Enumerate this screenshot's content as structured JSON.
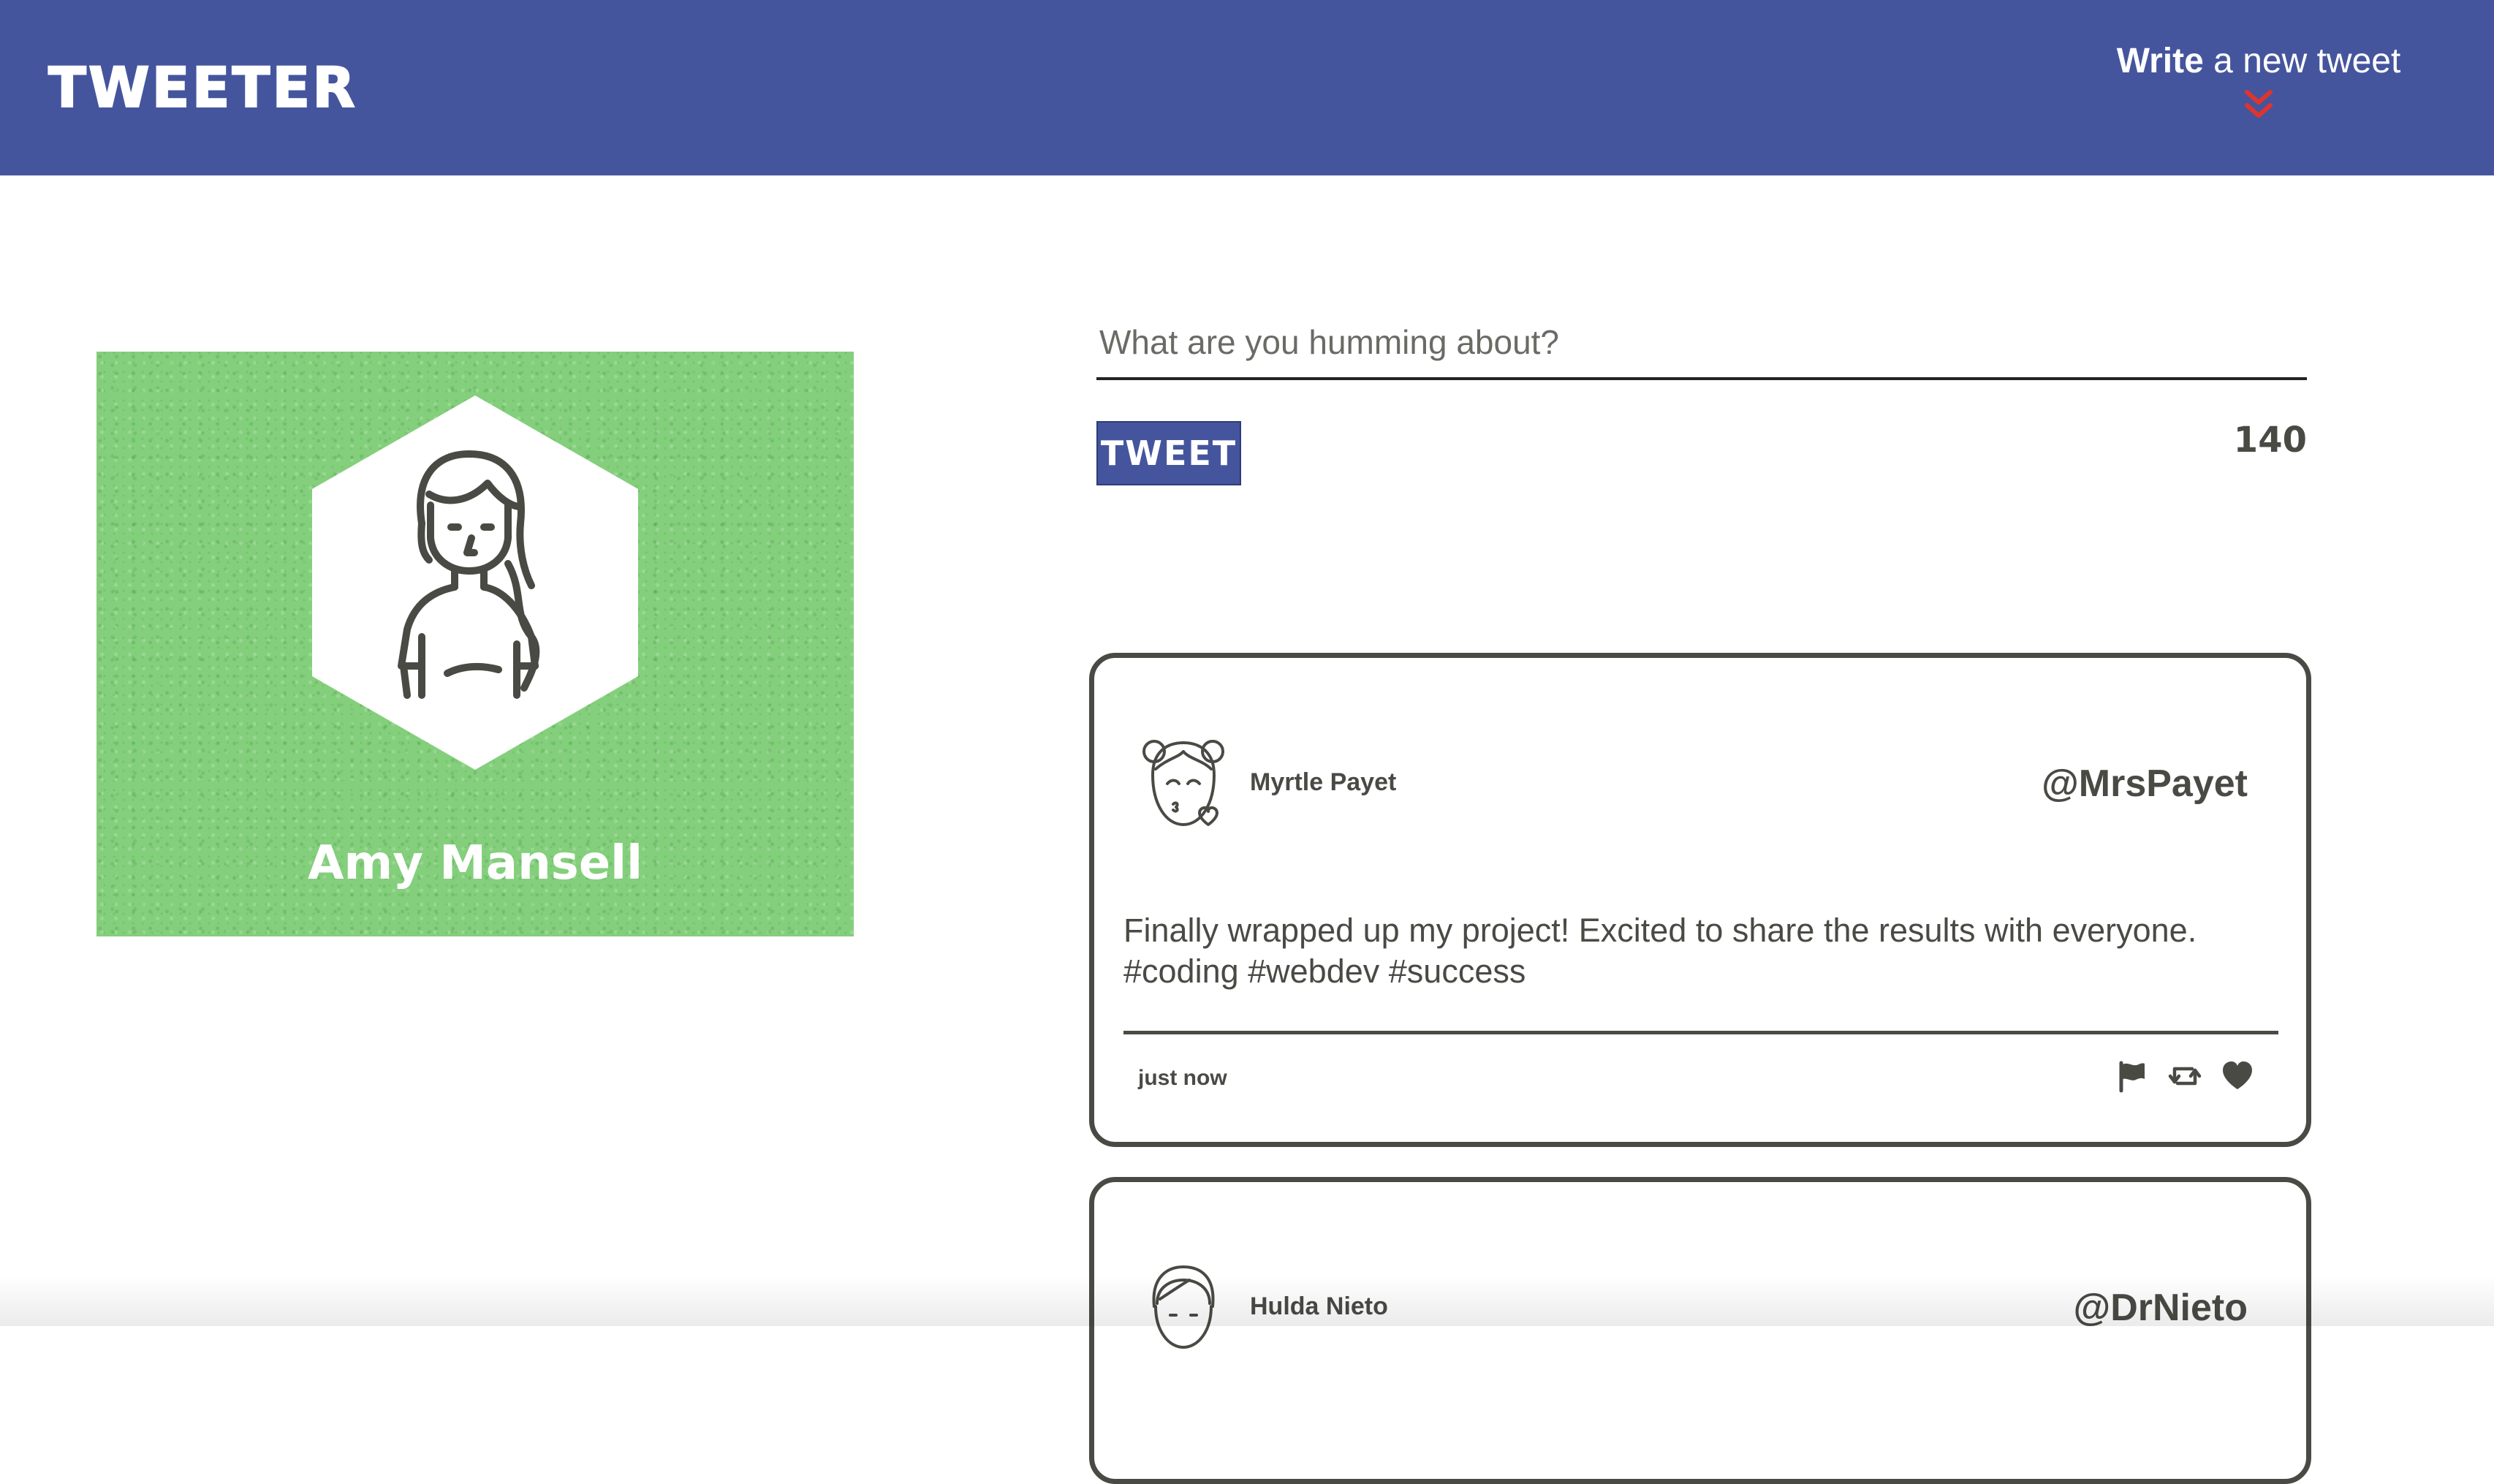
{
  "nav": {
    "brand": "TWEETER",
    "write_bold": "Write",
    "write_rest": " a new tweet",
    "accent": "#e0342d",
    "background": "#45559d"
  },
  "profile": {
    "name": "Amy Mansell",
    "background": "#84cf7c"
  },
  "compose": {
    "placeholder": "What are you humming about?",
    "button_label": "TWEET",
    "counter": "140"
  },
  "tweets": [
    {
      "name": "Myrtle Payet",
      "handle": "@MrsPayet",
      "content": "Finally wrapped up my project! Excited to share the results with everyone. #coding #webdev #success",
      "time": "just now",
      "actions": [
        "flag-icon",
        "retweet-icon",
        "heart-icon"
      ]
    },
    {
      "name": "Hulda Nieto",
      "handle": "@DrNieto"
    }
  ]
}
